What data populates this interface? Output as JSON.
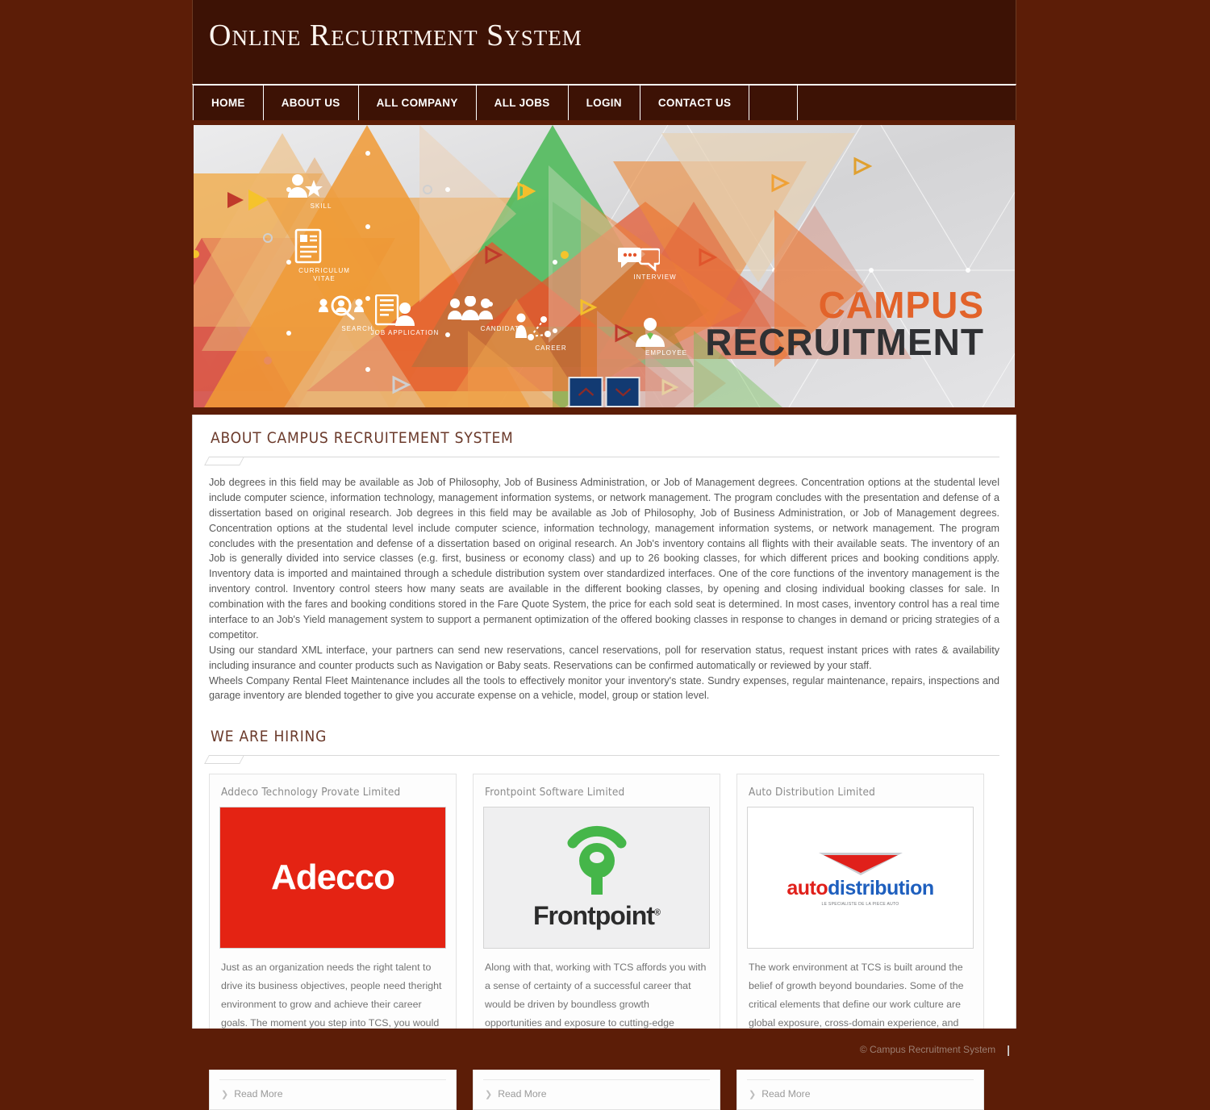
{
  "header": {
    "site_title": "Online Recuirtment System",
    "background": "#3d1205"
  },
  "nav": {
    "items": [
      {
        "label": "HOME"
      },
      {
        "label": "ABOUT US"
      },
      {
        "label": "ALL COMPANY"
      },
      {
        "label": "ALL JOBS"
      },
      {
        "label": "LOGIN"
      },
      {
        "label": "CONTACT US"
      }
    ]
  },
  "banner": {
    "title_top": "CAMPUS",
    "title_bottom": "RECRUITMENT",
    "title_top_color": "#e2632a",
    "title_bottom_color": "#2f3033",
    "icon_labels": [
      {
        "text": "SKILL"
      },
      {
        "text": "SEARCH"
      },
      {
        "text": "CANDIDATE"
      },
      {
        "text": "CURRICULUM VITAE"
      },
      {
        "text": "JOB APPLICATION"
      },
      {
        "text": "CAREER"
      },
      {
        "text": "INTERVIEW"
      },
      {
        "text": "EMPLOYEE"
      }
    ],
    "slider": {
      "prev_icon": "chevron-up-icon",
      "next_icon": "chevron-down-icon",
      "button_color": "#123a72",
      "chevron_color": "#8c2b28"
    }
  },
  "about": {
    "heading": "ABOUT CAMPUS RECRUITEMENT SYSTEM",
    "paragraphs": [
      "Job degrees in this field may be available as Job of Philosophy, Job of Business Administration, or Job of Management degrees. Concentration options at the studental level include computer science, information technology, management information systems, or network management. The program concludes with the presentation and defense of a dissertation based on original research. Job degrees in this field may be available as Job of Philosophy, Job of Business Administration, or Job of Management degrees. Concentration options at the studental level include computer science, information technology, management information systems, or network management. The program concludes with the presentation and defense of a dissertation based on original research. An Job's inventory contains all flights with their available seats. The inventory of an Job is generally divided into service classes (e.g. first, business or economy class) and up to 26 booking classes, for which different prices and booking conditions apply. Inventory data is imported and maintained through a schedule distribution system over standardized interfaces. One of the core functions of the inventory management is the inventory control. Inventory control steers how many seats are available in the different booking classes, by opening and closing individual booking classes for sale. In combination with the fares and booking conditions stored in the Fare Quote System, the price for each sold seat is determined. In most cases, inventory control has a real time interface to an Job's Yield management system to support a permanent optimization of the offered booking classes in response to changes in demand or pricing strategies of a competitor.",
      "Using our standard XML interface, your partners can send new reservations, cancel reservations, poll for reservation status, request instant prices with rates & availability including insurance and counter products such as Navigation or Baby seats. Reservations can be confirmed automatically or reviewed by your staff.",
      "Wheels Company Rental Fleet Maintenance includes all the tools to effectively monitor your inventory's state. Sundry expenses, regular maintenance, repairs, inspections and garage inventory are blended together to give you accurate expense on a vehicle, model, group or station level."
    ]
  },
  "hiring": {
    "heading": "WE ARE HIRING",
    "cards": [
      {
        "title": "Addeco Technology Provate Limited",
        "logo_name": "adecco-logo",
        "logo_text": "Adecco",
        "logo_bg": "#e42313",
        "description": "Just as an organization needs the right talent to drive its business objectives, people need theright environment to grow and achieve their career goals. The moment you step into TCS, you would be greeted with that unmistakable feeling of being at the right place.",
        "read_more": "Read More"
      },
      {
        "title": "Frontpoint Software Limited",
        "logo_name": "frontpoint-logo",
        "logo_text": "Frontpoint",
        "logo_bg": "#efeff0",
        "description": "Along with that, working with TCS affords you with a sense of certainty of a successful career that would be driven by boundless growth opportunities and exposure to cutting-edge technologies and learning possibilities.",
        "read_more": "Read More"
      },
      {
        "title": "Auto Distribution Limited",
        "logo_name": "autodistribution-logo",
        "logo_text_1": "auto",
        "logo_text_2": "distribution",
        "logo_tagline": "Le specialiste de la piece auto",
        "logo_bg": "#ffffff",
        "description": "The work environment at TCS is built around the belief of growth beyond boundaries. Some of the critical elements that define our work culture are global exposure, cross-domain experience, and work-life balance. Each of these elements goes much deeper than what it ostensibly conveys.",
        "read_more": "Read More"
      }
    ]
  },
  "footer": {
    "copyright": "© Campus Recruitment System",
    "separator": "|"
  },
  "theme": {
    "page_bg": "#5c1d07",
    "header_bg": "#3d1205",
    "heading_color": "#6b3a2b"
  }
}
